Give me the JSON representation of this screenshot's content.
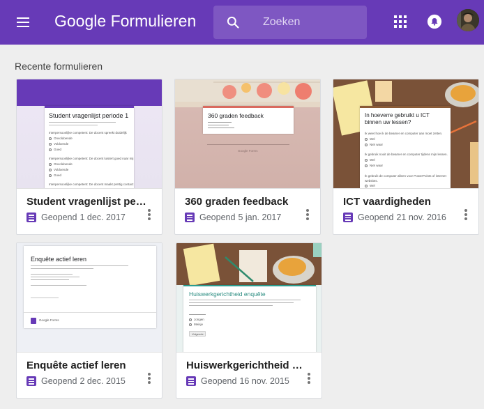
{
  "header": {
    "brand": "Google",
    "product": "Formulieren",
    "search_placeholder": "Zoeken",
    "icons": [
      "menu-icon",
      "search-icon",
      "apps-grid-icon",
      "notifications-bell-icon",
      "account-avatar"
    ]
  },
  "section": {
    "title": "Recente formulieren"
  },
  "colors": {
    "appbar": "#673ab7",
    "search": "#7e57c2",
    "form_icon": "#673ab7",
    "background": "#eeeeee"
  },
  "cards": [
    {
      "name": "Student vragenlijst period…",
      "status": "Geopend",
      "date": "1 dec. 2017",
      "preview_title": "Student vragenlijst periode 1",
      "preview_q1": "Interpersoonlijke competent: De docent spreekt duidelijk",
      "preview_q2": "Interpersoonlijke competent: De docent luistert goed naar mij",
      "preview_q3": "Interpersoonlijke competent: De docent maakt prettig contact",
      "preview_opts": [
        "Onvoldoende",
        "Voldoende",
        "Goed"
      ]
    },
    {
      "name": "360 graden feedback",
      "status": "Geopend",
      "date": "5 jan. 2017",
      "preview_title": "360 graden feedback",
      "preview_footer": "Google Forms"
    },
    {
      "name": "ICT vaardigheden",
      "status": "Geopend",
      "date": "21 nov. 2016",
      "preview_title": "In hoeverre gebruikt u ICT binnen uw lessen?",
      "preview_q1": "Ik weet hoe ik de beamer en computer aan moet zetten.",
      "preview_q2": "Ik gebruik nooit de beamer en computer tijdens mijn lessen.",
      "preview_q3": "Ik gebruik de computer alleen voor PowerPoints of internet websites.",
      "preview_opts": [
        "Wel",
        "Niet waar"
      ]
    },
    {
      "name": "Enquête actief leren",
      "status": "Geopend",
      "date": "2 dec. 2015",
      "preview_title": "Enquête actief leren",
      "preview_footer": "Google Forms"
    },
    {
      "name": "Huiswerkgerichtheid enq…",
      "status": "Geopend",
      "date": "16 nov. 2015",
      "preview_title": "Huiswerkgerichtheid enquête",
      "preview_opts": [
        "Jongen",
        "Meisje"
      ],
      "preview_button": "Volgende"
    }
  ]
}
